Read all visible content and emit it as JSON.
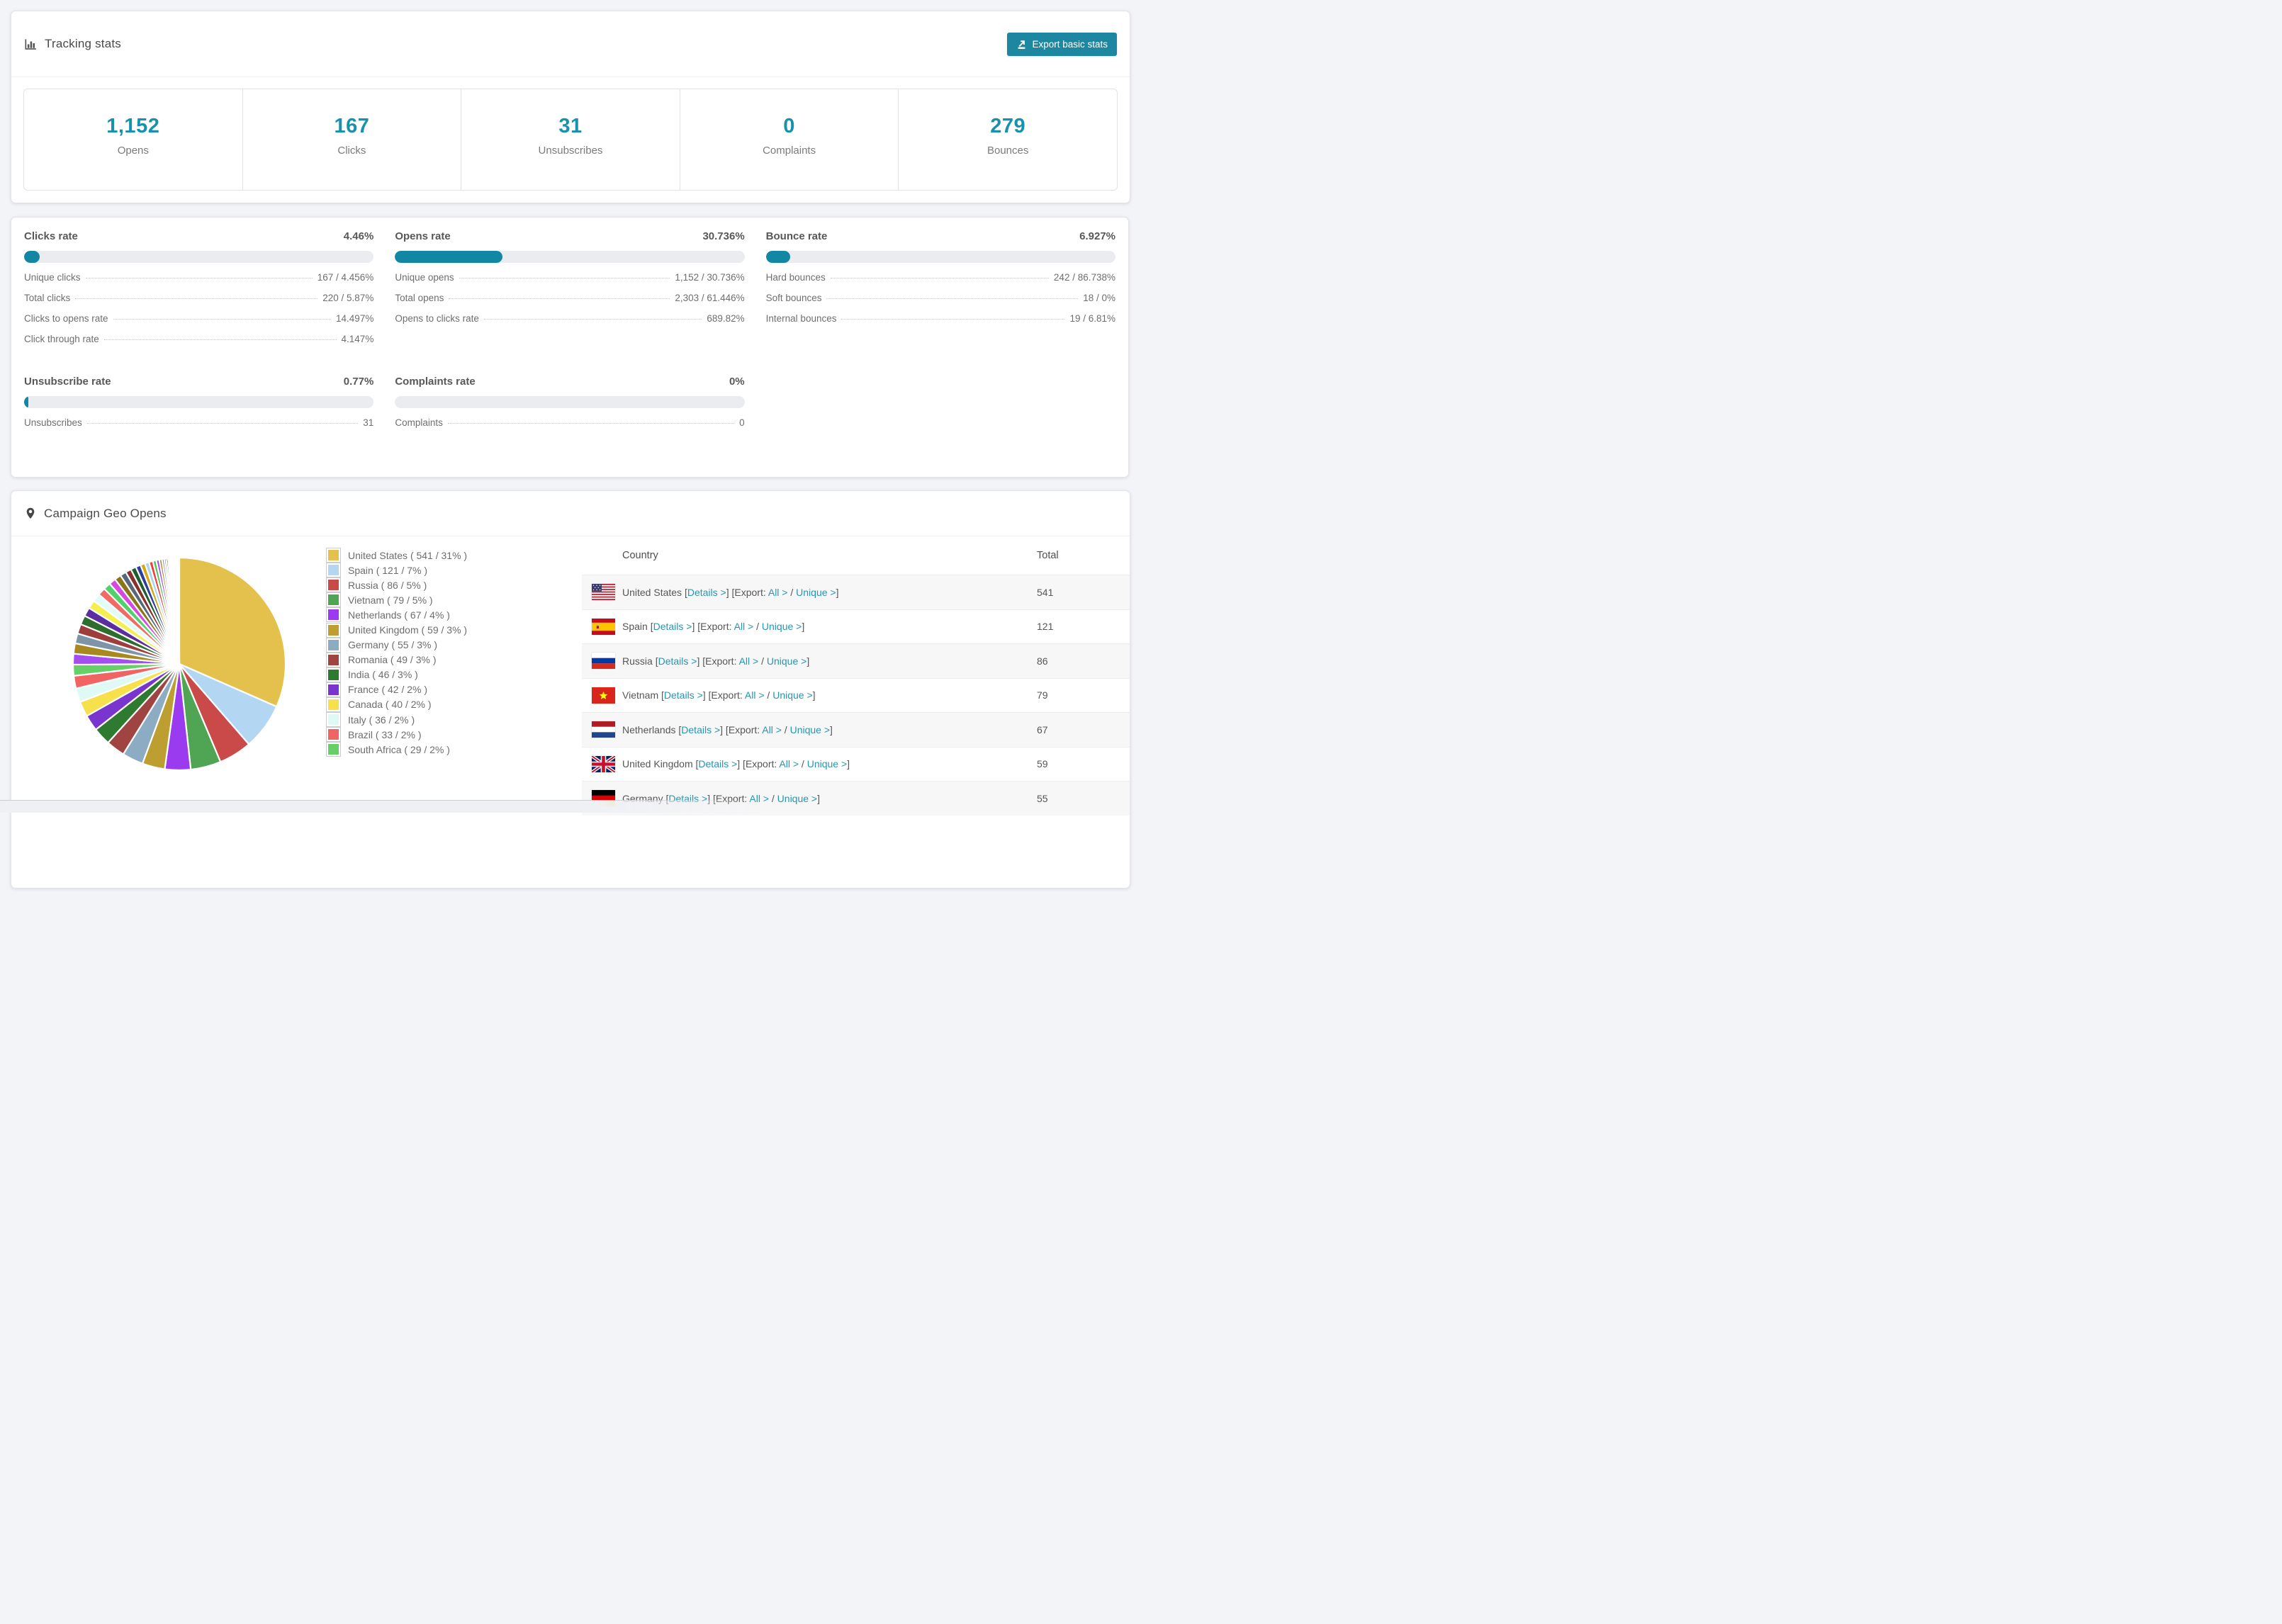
{
  "page": {
    "background": "#f3f4f8",
    "accent_teal": "#1d87a2",
    "link_color": "#2596b3",
    "stat_number_color": "#1791ad"
  },
  "tracking": {
    "title": "Tracking stats",
    "export_button": "Export basic stats",
    "stats": [
      {
        "value": "1,152",
        "label": "Opens"
      },
      {
        "value": "167",
        "label": "Clicks"
      },
      {
        "value": "31",
        "label": "Unsubscribes"
      },
      {
        "value": "0",
        "label": "Complaints"
      },
      {
        "value": "279",
        "label": "Bounces"
      }
    ]
  },
  "rates": {
    "sections": [
      {
        "title": "Clicks rate",
        "rate": "4.46%",
        "percent": 4.46,
        "rows": [
          {
            "label": "Unique clicks",
            "value": "167 / 4.456%"
          },
          {
            "label": "Total clicks",
            "value": "220 / 5.87%"
          },
          {
            "label": "Clicks to opens rate",
            "value": "14.497%"
          },
          {
            "label": "Click through rate",
            "value": "4.147%"
          }
        ]
      },
      {
        "title": "Opens rate",
        "rate": "30.736%",
        "percent": 30.736,
        "rows": [
          {
            "label": "Unique opens",
            "value": "1,152 / 30.736%"
          },
          {
            "label": "Total opens",
            "value": "2,303 / 61.446%"
          },
          {
            "label": "Opens to clicks rate",
            "value": "689.82%"
          }
        ]
      },
      {
        "title": "Bounce rate",
        "rate": "6.927%",
        "percent": 6.927,
        "rows": [
          {
            "label": "Hard bounces",
            "value": "242 / 86.738%"
          },
          {
            "label": "Soft bounces",
            "value": "18 / 0%"
          },
          {
            "label": "Internal bounces",
            "value": "19 / 6.81%"
          }
        ]
      },
      {
        "title": "Unsubscribe rate",
        "rate": "0.77%",
        "percent": 0.77,
        "rows": [
          {
            "label": "Unsubscribes",
            "value": "31"
          }
        ]
      },
      {
        "title": "Complaints rate",
        "rate": "0%",
        "percent": 0,
        "rows": [
          {
            "label": "Complaints",
            "value": "0"
          }
        ]
      }
    ]
  },
  "geo": {
    "title": "Campaign Geo Opens",
    "legend": [
      {
        "label": "United States ( 541 / 31% )",
        "color": "#e4c04d"
      },
      {
        "label": "Spain ( 121 / 7% )",
        "color": "#b3d7f2"
      },
      {
        "label": "Russia ( 86 / 5% )",
        "color": "#ca4a4a"
      },
      {
        "label": "Vietnam ( 79 / 5% )",
        "color": "#4fa553"
      },
      {
        "label": "Netherlands ( 67 / 4% )",
        "color": "#9a3bf0"
      },
      {
        "label": "United Kingdom ( 59 / 3% )",
        "color": "#bd9e31"
      },
      {
        "label": "Germany ( 55 / 3% )",
        "color": "#8cacc4"
      },
      {
        "label": "Romania ( 49 / 3% )",
        "color": "#a04442"
      },
      {
        "label": "India ( 46 / 3% )",
        "color": "#2f7a31"
      },
      {
        "label": "France ( 42 / 2% )",
        "color": "#7b35cf"
      },
      {
        "label": "Canada ( 40 / 2% )",
        "color": "#f6e04b"
      },
      {
        "label": "Italy ( 36 / 2% )",
        "color": "#dffaf4"
      },
      {
        "label": "Brazil ( 33 / 2% )",
        "color": "#f16464"
      },
      {
        "label": "South Africa ( 29 / 2% )",
        "color": "#65cf68"
      }
    ],
    "table": {
      "headers": {
        "country": "Country",
        "total": "Total"
      },
      "links": {
        "details": "Details >",
        "export": "Export:",
        "all": "All >",
        "unique": "Unique >",
        "bracket_open": "[",
        "bracket_close": "]",
        "separator": "/"
      },
      "rows": [
        {
          "country": "United States",
          "flag": "us",
          "total": "541"
        },
        {
          "country": "Spain",
          "flag": "es",
          "total": "121"
        },
        {
          "country": "Russia",
          "flag": "ru",
          "total": "86"
        },
        {
          "country": "Vietnam",
          "flag": "vn",
          "total": "79"
        },
        {
          "country": "Netherlands",
          "flag": "nl",
          "total": "67"
        },
        {
          "country": "United Kingdom",
          "flag": "gb",
          "total": "59"
        },
        {
          "country": "Germany",
          "flag": "de",
          "total": "55"
        }
      ]
    }
  },
  "chart_data": {
    "type": "pie",
    "title": "Campaign Geo Opens",
    "start_angle_deg": -90,
    "direction": "clockwise",
    "slices": [
      {
        "label": "United States",
        "value": 541,
        "pct": 31,
        "color": "#e4c04d"
      },
      {
        "label": "Spain",
        "value": 121,
        "pct": 7,
        "color": "#b3d7f2"
      },
      {
        "label": "Russia",
        "value": 86,
        "pct": 5,
        "color": "#ca4a4a"
      },
      {
        "label": "Vietnam",
        "value": 79,
        "pct": 5,
        "color": "#4fa553"
      },
      {
        "label": "Netherlands",
        "value": 67,
        "pct": 4,
        "color": "#9a3bf0"
      },
      {
        "label": "United Kingdom",
        "value": 59,
        "pct": 3,
        "color": "#bd9e31"
      },
      {
        "label": "Germany",
        "value": 55,
        "pct": 3,
        "color": "#8cacc4"
      },
      {
        "label": "Romania",
        "value": 49,
        "pct": 3,
        "color": "#a04442"
      },
      {
        "label": "India",
        "value": 46,
        "pct": 3,
        "color": "#2f7a31"
      },
      {
        "label": "France",
        "value": 42,
        "pct": 2,
        "color": "#7b35cf"
      },
      {
        "label": "Canada",
        "value": 40,
        "pct": 2,
        "color": "#f6e04b"
      },
      {
        "label": "Italy",
        "value": 36,
        "pct": 2,
        "color": "#dffaf4"
      },
      {
        "label": "Brazil",
        "value": 33,
        "pct": 2,
        "color": "#f16464"
      },
      {
        "label": "South Africa",
        "value": 29,
        "pct": 2,
        "color": "#65cf68"
      }
    ],
    "other_slices": {
      "description": "many small unlabeled country slices completing the remaining ~26% of the circle",
      "values": [
        28,
        27,
        26,
        25,
        24,
        23,
        22,
        21,
        20,
        19,
        18,
        17,
        16,
        15,
        14,
        13,
        12,
        11,
        10,
        9,
        8,
        7,
        6,
        5,
        5,
        4,
        4,
        3,
        3,
        2,
        2,
        2,
        2,
        1,
        1,
        1,
        1,
        1,
        1,
        1
      ],
      "palette": [
        "#a44df0",
        "#a8891f",
        "#7e95a8",
        "#9d3e3c",
        "#2d6e2f",
        "#5b2da0",
        "#f4ee4e",
        "#e1fbf6",
        "#f26a66",
        "#52d06b",
        "#d44ae0",
        "#8a7519",
        "#56687a",
        "#86322d",
        "#1f5f2c",
        "#2c3e9e",
        "#d3a818",
        "#a8d4f2",
        "#e8413c",
        "#5bbf63"
      ]
    }
  }
}
